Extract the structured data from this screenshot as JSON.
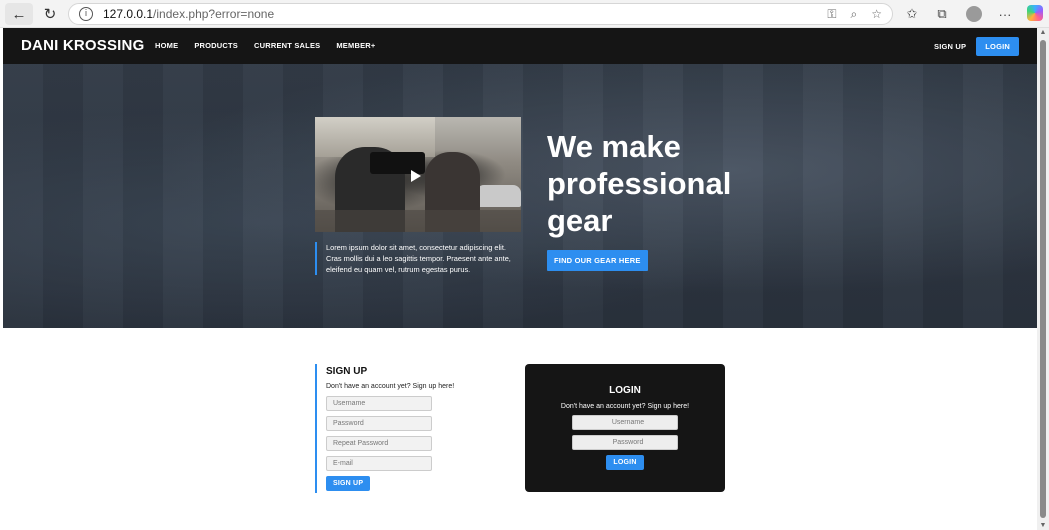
{
  "browser": {
    "url_host": "127.0.0.1",
    "url_path": "/index.php?error=none"
  },
  "nav": {
    "brand": "DANI KROSSING",
    "links": [
      "HOME",
      "PRODUCTS",
      "CURRENT SALES",
      "MEMBER+"
    ],
    "signup": "SIGN UP",
    "login": "LOGIN"
  },
  "hero": {
    "title": "We make professional gear",
    "caption": "Lorem ipsum dolor sit amet, consectetur adipiscing elit. Cras mollis dui a leo sagittis tempor. Praesent ante ante, eleifend eu quam vel, rutrum egestas purus.",
    "cta": "FIND OUR GEAR HERE"
  },
  "signup": {
    "title": "SIGN UP",
    "subtitle": "Don't have an account yet? Sign up here!",
    "username_placeholder": "Username",
    "password_placeholder": "Password",
    "repeat_placeholder": "Repeat Password",
    "email_placeholder": "E-mail",
    "button": "SIGN UP"
  },
  "login": {
    "title": "LOGIN",
    "subtitle": "Don't have an account yet? Sign up here!",
    "username_placeholder": "Username",
    "password_placeholder": "Password",
    "button": "LOGIN"
  }
}
